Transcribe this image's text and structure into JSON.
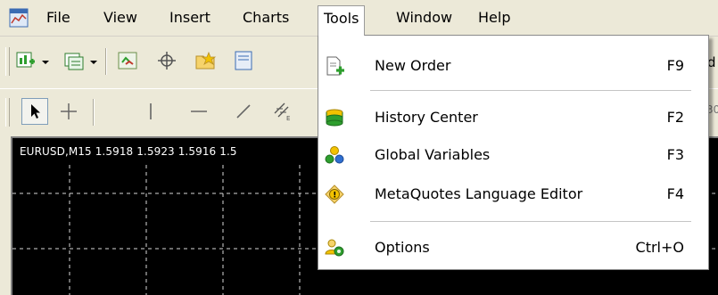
{
  "menubar": {
    "items": [
      {
        "label": "File"
      },
      {
        "label": "View"
      },
      {
        "label": "Insert"
      },
      {
        "label": "Charts"
      },
      {
        "label": "Tools"
      },
      {
        "label": "Window"
      },
      {
        "label": "Help"
      }
    ],
    "active_item": "Tools"
  },
  "toolbar": {
    "right_fragment_1": "d",
    "right_fragment_2": "30"
  },
  "chart": {
    "title": "EURUSD,M15  1.5918 1.5923 1.5916 1.5",
    "background": "#000000",
    "grid_color": "#ffffff"
  },
  "tools_menu": {
    "items": [
      {
        "label": "New Order",
        "shortcut": "F9",
        "icon": "new-order-icon"
      },
      {
        "label": "History Center",
        "shortcut": "F2",
        "icon": "history-center-icon"
      },
      {
        "label": "Global Variables",
        "shortcut": "F3",
        "icon": "global-variables-icon"
      },
      {
        "label": "MetaQuotes Language Editor",
        "shortcut": "F4",
        "icon": "metaeditor-icon"
      },
      {
        "label": "Options",
        "shortcut": "Ctrl+O",
        "icon": "options-icon"
      }
    ]
  },
  "colors": {
    "chrome": "#ece9d8",
    "menu_bg": "#ffffff",
    "accent_green": "#2e9e2e",
    "accent_yellow": "#f2c200"
  }
}
